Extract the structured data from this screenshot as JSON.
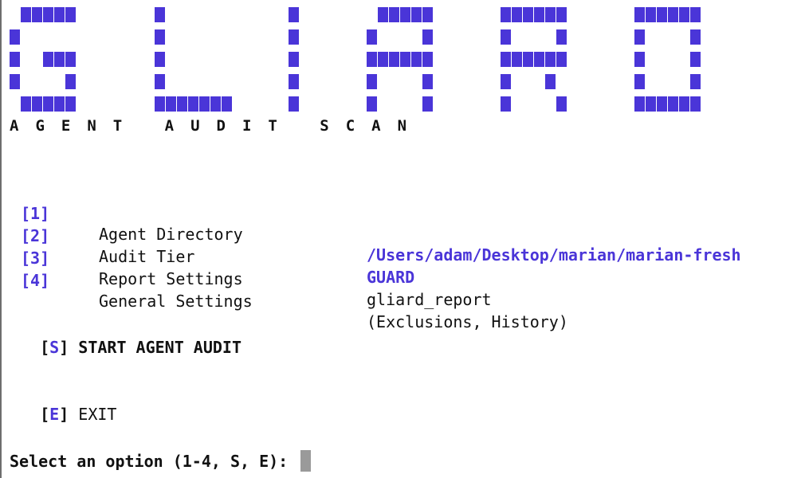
{
  "banner": {
    "logo_text": "GLIARD",
    "subtitle": "AGENT AUDIT SCAN",
    "pixel_color": "#4a35d8"
  },
  "menu": [
    {
      "key": "1",
      "label": "Agent Directory",
      "value": "/Users/adam/Desktop/marian/marian-fresh"
    },
    {
      "key": "2",
      "label": "Audit Tier",
      "value": "GUARD"
    },
    {
      "key": "3",
      "label": "Report Settings",
      "value": "gliard_report"
    },
    {
      "key": "4",
      "label": "General Settings",
      "value": "(Exclusions, History)"
    }
  ],
  "actions": {
    "start": {
      "key": "S",
      "label": "START AGENT AUDIT"
    },
    "exit": {
      "key": "E",
      "label": "EXIT"
    }
  },
  "prompt": {
    "text": "Select an option (1-4, S, E): "
  },
  "colors": {
    "accent": "#4a35d8",
    "text": "#111111",
    "cursor": "#9a9a9a"
  }
}
